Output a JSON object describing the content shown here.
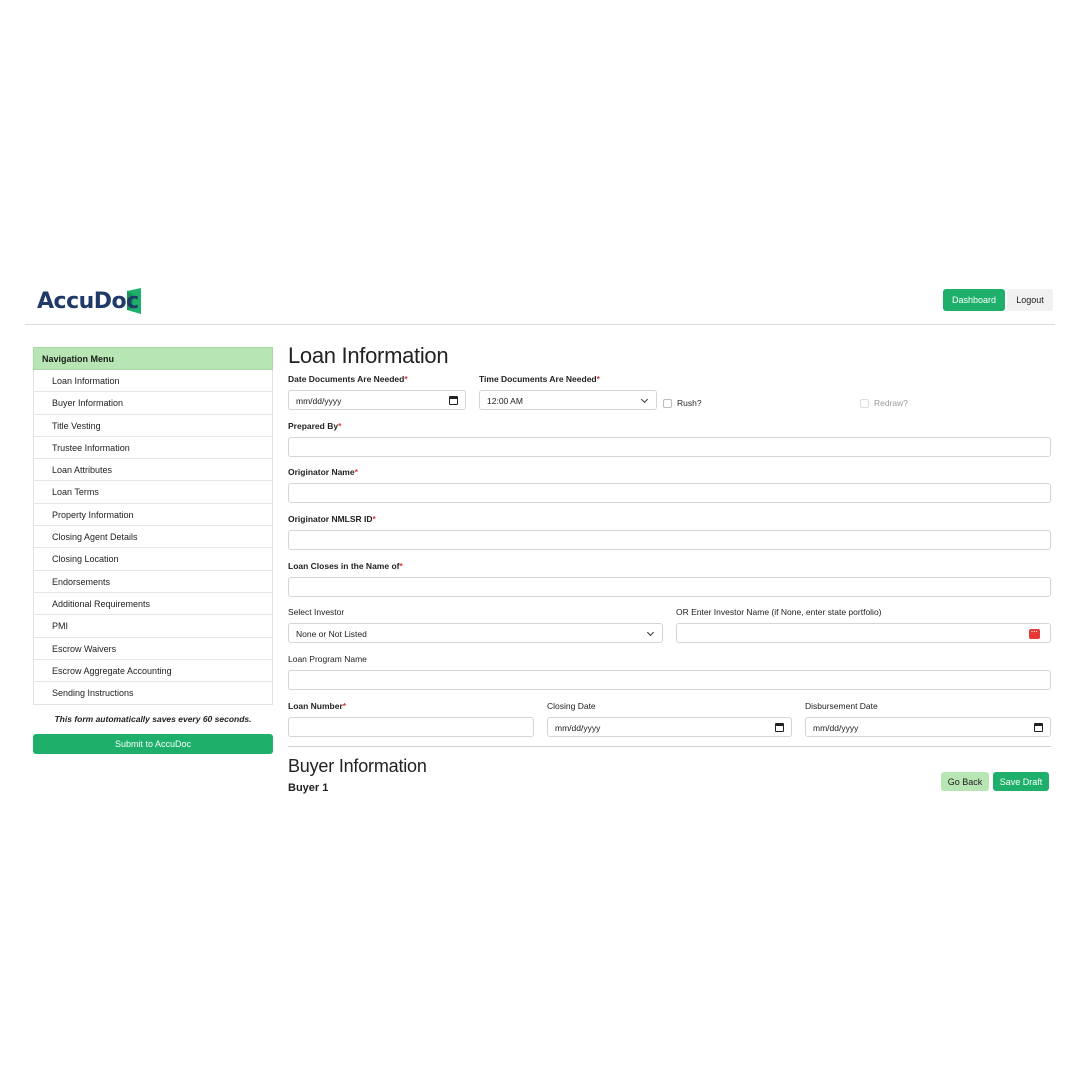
{
  "header": {
    "logo_text": "AccuDoc",
    "dashboard_label": "Dashboard",
    "logout_label": "Logout"
  },
  "sidebar": {
    "title": "Navigation Menu",
    "items": [
      {
        "label": "Loan Information"
      },
      {
        "label": "Buyer Information"
      },
      {
        "label": "Title Vesting"
      },
      {
        "label": "Trustee Information"
      },
      {
        "label": "Loan Attributes"
      },
      {
        "label": "Loan Terms"
      },
      {
        "label": "Property Information"
      },
      {
        "label": "Closing Agent Details"
      },
      {
        "label": "Closing Location"
      },
      {
        "label": "Endorsements"
      },
      {
        "label": "Additional Requirements"
      },
      {
        "label": "PMI"
      },
      {
        "label": "Escrow Waivers"
      },
      {
        "label": "Escrow Aggregate Accounting"
      },
      {
        "label": "Sending Instructions"
      }
    ],
    "autosave_note": "This form automatically saves every 60 seconds.",
    "submit_label": "Submit to AccuDoc"
  },
  "form": {
    "title": "Loan Information",
    "required_marker": "*",
    "date_needed": {
      "label": "Date Documents Are Needed",
      "value": "mm/dd/yyyy"
    },
    "time_needed": {
      "label": "Time Documents Are Needed",
      "value": "12:00 AM"
    },
    "rush_label": "Rush?",
    "redraw_label": "Redraw?",
    "prepared_by": {
      "label": "Prepared By",
      "value": ""
    },
    "originator_name": {
      "label": "Originator Name",
      "value": ""
    },
    "originator_nmlsr": {
      "label": "Originator NMLSR ID",
      "value": ""
    },
    "closes_in_name_of": {
      "label": "Loan Closes in the Name of",
      "value": ""
    },
    "select_investor": {
      "label": "Select Investor",
      "value": "None or Not Listed"
    },
    "investor_name": {
      "label": "OR Enter Investor Name (if None, enter state portfolio)",
      "value": ""
    },
    "loan_program_name": {
      "label": "Loan Program Name",
      "value": ""
    },
    "loan_number": {
      "label": "Loan Number",
      "value": ""
    },
    "closing_date": {
      "label": "Closing Date",
      "value": "mm/dd/yyyy"
    },
    "disbursement_date": {
      "label": "Disbursement Date",
      "value": "mm/dd/yyyy"
    }
  },
  "buyer_section": {
    "title": "Buyer Information",
    "subtitle": "Buyer 1",
    "go_back_label": "Go Back",
    "save_draft_label": "Save Draft"
  },
  "colors": {
    "accent_green": "#1eb06b",
    "light_green": "#b7e5b4",
    "logo_navy": "#1f3a68",
    "required_red": "#dc3545"
  }
}
